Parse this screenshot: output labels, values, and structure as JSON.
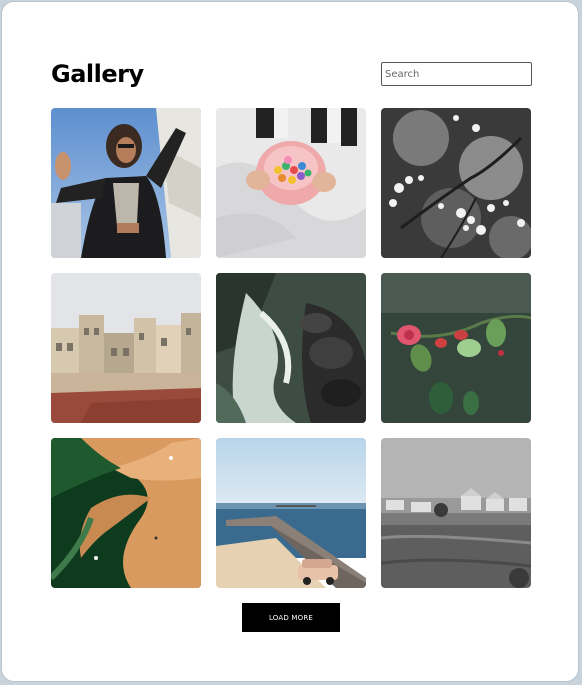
{
  "header": {
    "title": "Gallery"
  },
  "search": {
    "placeholder": "Search",
    "value": ""
  },
  "gallery": {
    "photos": [
      {
        "subject": "woman-leather-jacket"
      },
      {
        "subject": "pink-cup-candies"
      },
      {
        "subject": "white-blossoms-bw"
      },
      {
        "subject": "city-buildings"
      },
      {
        "subject": "river-rapids-rocks"
      },
      {
        "subject": "red-flowers-rain"
      },
      {
        "subject": "aerial-sandbar"
      },
      {
        "subject": "pier-beach-car"
      },
      {
        "subject": "grassland-houses-bw"
      }
    ]
  },
  "actions": {
    "load_more_label": "LOAD MORE"
  },
  "colors": {
    "page_bg": "#ffffff",
    "button_bg": "#000000",
    "button_text": "#ffffff",
    "frame_border": "#b9c4ce"
  }
}
